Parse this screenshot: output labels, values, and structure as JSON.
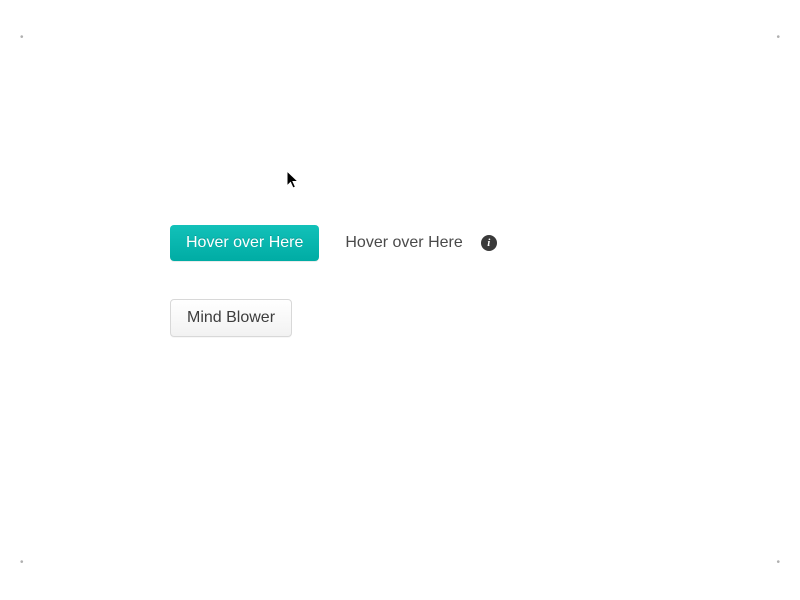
{
  "buttons": {
    "primary_hover_label": "Hover over Here",
    "mind_blower_label": "Mind Blower"
  },
  "text": {
    "hover_over_here": "Hover over Here"
  },
  "icons": {
    "info_glyph": "i"
  },
  "corners": {
    "mark": "•"
  }
}
